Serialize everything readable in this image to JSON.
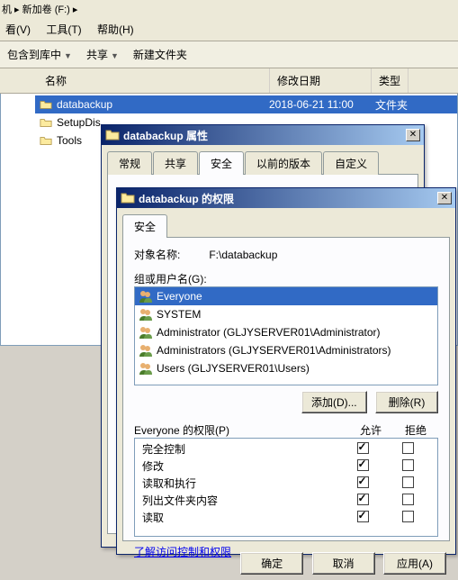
{
  "title_path": "机 ▸ 新加卷 (F:) ▸",
  "menu": {
    "view": "看(V)",
    "tools": "工具(T)",
    "help": "帮助(H)"
  },
  "toolbar": {
    "include": "包含到库中",
    "share": "共享",
    "newfolder": "新建文件夹"
  },
  "columns": {
    "name": "名称",
    "date": "修改日期",
    "type": "类型"
  },
  "rows": [
    {
      "name": "databackup",
      "date": "2018-06-21 11:00",
      "type": "文件夹",
      "sel": true
    },
    {
      "name": "SetupDis",
      "date": "",
      "type": "",
      "sel": false
    },
    {
      "name": "Tools",
      "date": "",
      "type": "",
      "sel": false
    }
  ],
  "dlg1": {
    "title": "databackup 属性",
    "tabs": [
      "常规",
      "共享",
      "安全",
      "以前的版本",
      "自定义"
    ],
    "active": 2
  },
  "dlg2": {
    "title": "databackup 的权限",
    "tab": "安全",
    "object_label": "对象名称:",
    "object_value": "F:\\databackup",
    "groups_label": "组或用户名(G):",
    "groups": [
      {
        "name": "Everyone",
        "sel": true
      },
      {
        "name": "SYSTEM"
      },
      {
        "name": "Administrator (GLJYSERVER01\\Administrator)"
      },
      {
        "name": "Administrators (GLJYSERVER01\\Administrators)"
      },
      {
        "name": "Users (GLJYSERVER01\\Users)"
      }
    ],
    "add_btn": "添加(D)...",
    "remove_btn": "删除(R)",
    "perm_for": "Everyone 的权限(P)",
    "allow": "允许",
    "deny": "拒绝",
    "perms": [
      {
        "name": "完全控制",
        "allow": true,
        "deny": false
      },
      {
        "name": "修改",
        "allow": true,
        "deny": false
      },
      {
        "name": "读取和执行",
        "allow": true,
        "deny": false
      },
      {
        "name": "列出文件夹内容",
        "allow": true,
        "deny": false
      },
      {
        "name": "读取",
        "allow": true,
        "deny": false
      }
    ],
    "link": "了解访问控制和权限",
    "ok": "确定",
    "cancel": "取消",
    "apply": "应用(A)"
  }
}
